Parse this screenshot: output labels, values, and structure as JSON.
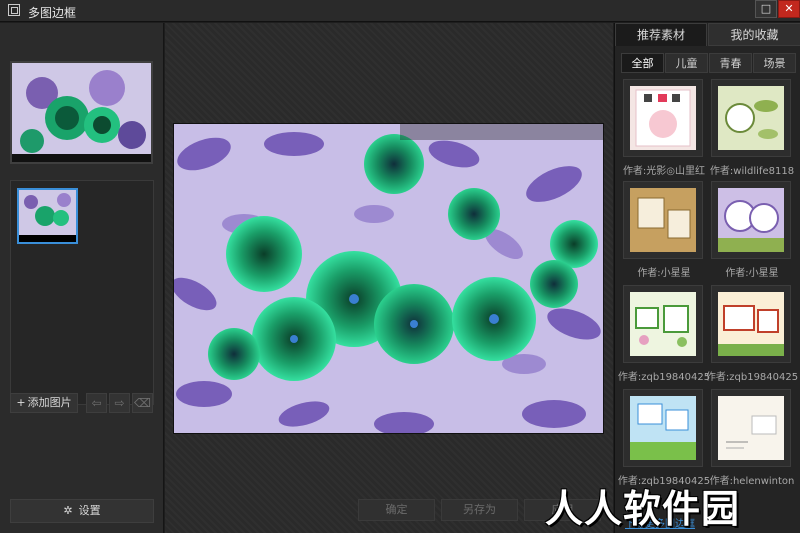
{
  "window": {
    "title": "多图边框",
    "max_icon": "maximize-icon",
    "close_icon": "close-icon"
  },
  "left_panel": {
    "add_button_label": "添加图片",
    "settings_label": "设置"
  },
  "center": {
    "buttons": {
      "ok": "确定",
      "save_as": "另存为",
      "apply": "应用"
    }
  },
  "right_panel": {
    "tabs": [
      "推荐素材",
      "我的收藏"
    ],
    "categories": [
      "全部",
      "儿童",
      "青春",
      "场景"
    ],
    "items": [
      {
        "author": "作者:光影◎山里红"
      },
      {
        "author": "作者:wildlife8118"
      },
      {
        "author": "作者:小星星"
      },
      {
        "author": "作者:小星星"
      },
      {
        "author": "作者:zqb19840425"
      },
      {
        "author": "作者:zqb19840425"
      },
      {
        "author": "作者:zqb19840425"
      },
      {
        "author": "作者:helenwinton"
      }
    ],
    "download_link": "下载更多图边框"
  },
  "watermark": "人人软件园",
  "colors": {
    "accent": "#3a8fd9",
    "close": "#c2281e",
    "panel": "#2b2b2b"
  }
}
